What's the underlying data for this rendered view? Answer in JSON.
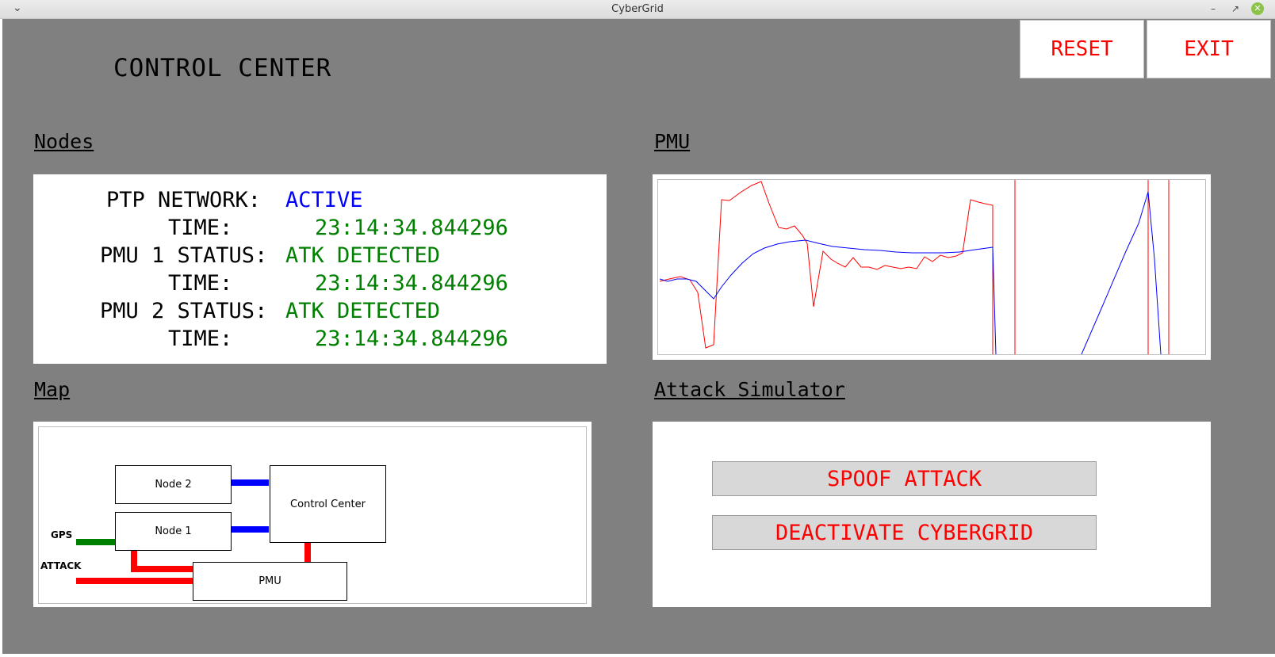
{
  "window": {
    "title": "CyberGrid",
    "menu_icon": "chevron-down-icon",
    "controls": [
      "minimize-icon",
      "maximize-icon",
      "close-icon"
    ]
  },
  "header": {
    "title": "CONTROL CENTER",
    "reset_label": "RESET",
    "exit_label": "EXIT"
  },
  "sections": {
    "nodes": "Nodes",
    "pmu": "PMU",
    "map": "Map",
    "attack": "Attack Simulator"
  },
  "nodes": {
    "ptp_label": "PTP NETWORK:",
    "ptp_value": "ACTIVE",
    "time_label": "TIME:",
    "ptp_time": "23:14:34.844296",
    "pmu1_label": "PMU 1 STATUS:",
    "pmu1_value": "ATK DETECTED",
    "pmu1_time": "23:14:34.844296",
    "pmu2_label": "PMU 2 STATUS:",
    "pmu2_value": "ATK DETECTED",
    "pmu2_time": "23:14:34.844296"
  },
  "map": {
    "node2": "Node 2",
    "node1": "Node 1",
    "control_center": "Control Center",
    "pmu": "PMU",
    "gps": "GPS",
    "attack": "ATTACK"
  },
  "attack_simulator": {
    "spoof_label": "SPOOF ATTACK",
    "deactivate_label": "DEACTIVATE CYBERGRID"
  },
  "colors": {
    "background": "#808080",
    "alert": "#ff0000",
    "active": "#0000ff",
    "ok": "#008000"
  }
}
